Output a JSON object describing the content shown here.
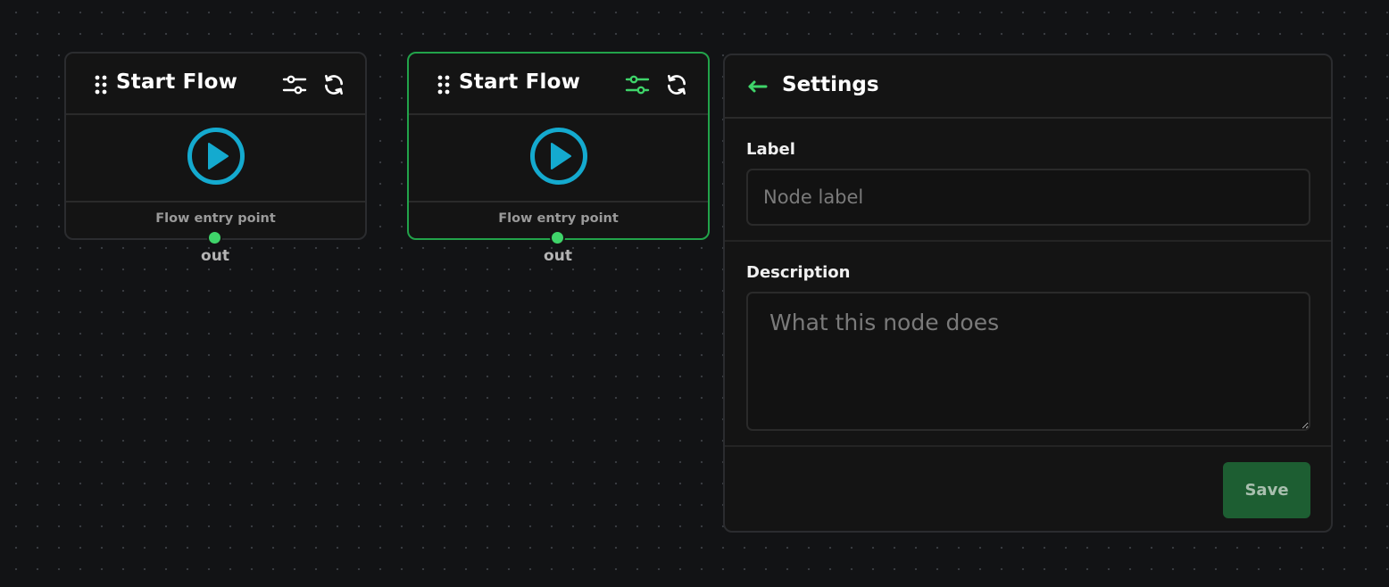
{
  "colors": {
    "canvas_background": "#121315",
    "node_border": "#2b2c2f",
    "selected_border": "#22a34a",
    "accent_green": "#3fd46a",
    "play_icon": "#14aacf",
    "save_button": "#1d5e32"
  },
  "nodes": [
    {
      "title": "Start Flow",
      "footer": "Flow entry point",
      "port_label": "out",
      "selected": false,
      "icons": [
        "drag-handle-icon",
        "sliders-icon",
        "refresh-icon",
        "play-circle-icon"
      ]
    },
    {
      "title": "Start Flow",
      "footer": "Flow entry point",
      "port_label": "out",
      "selected": true,
      "icons": [
        "drag-handle-icon",
        "sliders-icon",
        "refresh-icon",
        "play-circle-icon"
      ]
    }
  ],
  "settings_panel": {
    "title": "Settings",
    "back_icon": "arrow-left-icon",
    "label_field": {
      "label": "Label",
      "value": "",
      "placeholder": "Node label"
    },
    "description_field": {
      "label": "Description",
      "value": "",
      "placeholder": "What this node does"
    },
    "save_label": "Save"
  }
}
